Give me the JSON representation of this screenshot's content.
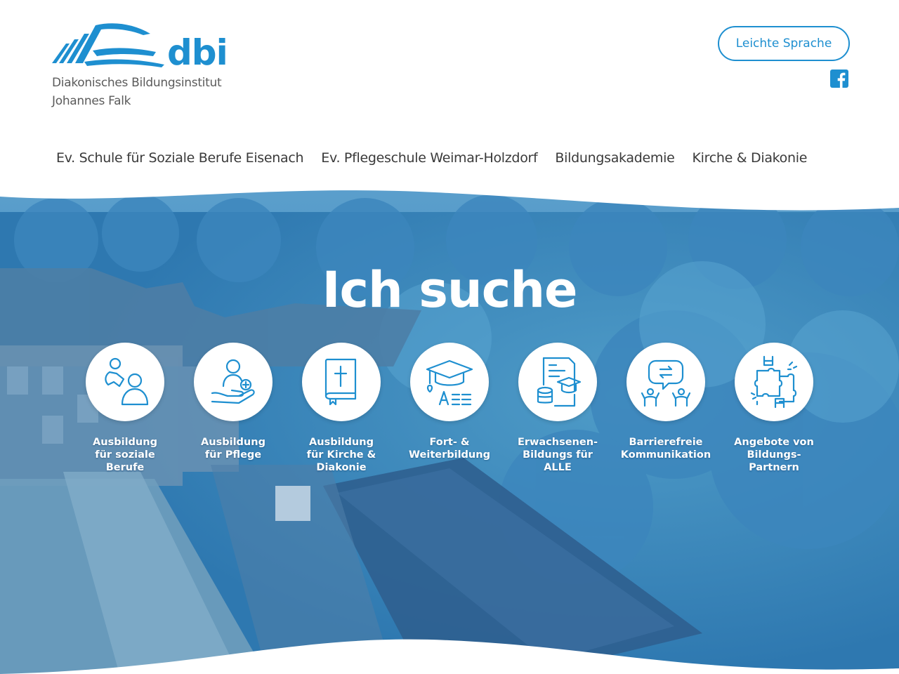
{
  "header": {
    "logo": {
      "short": "dbi",
      "line1": "Diakonisches Bildungsinstitut",
      "line2": "Johannes Falk"
    },
    "leichte_sprache": "Leichte Sprache",
    "facebook_icon": "facebook-icon"
  },
  "nav": {
    "items": [
      {
        "label": "Ev. Schule für Soziale Berufe Eisenach"
      },
      {
        "label": "Ev. Pflegeschule Weimar-Holzdorf"
      },
      {
        "label": "Bildungsakademie"
      },
      {
        "label": "Kirche & Diakonie"
      }
    ]
  },
  "hero": {
    "title": "Ich suche",
    "categories": [
      {
        "label": "Ausbildung\nfür soziale\nBerufe",
        "icon": "parent-child-icon"
      },
      {
        "label": "Ausbildung\nfür Pflege",
        "icon": "care-hand-icon"
      },
      {
        "label": "Ausbildung\nfür Kirche &\nDiakonie",
        "icon": "bible-icon"
      },
      {
        "label": "Fort- &\nWeiterbildung",
        "icon": "graduation-cap-icon"
      },
      {
        "label": "Erwachsenen-\nBildungs für\nALLE",
        "icon": "document-cap-icon"
      },
      {
        "label": "Barrierefreie\nKommunikation",
        "icon": "communication-icon"
      },
      {
        "label": "Angebote von\nBildungs-\nPartnern",
        "icon": "puzzle-icon"
      }
    ]
  },
  "colors": {
    "brand_blue": "#1e8fd0",
    "hero_overlay": "#2a7fbf"
  }
}
